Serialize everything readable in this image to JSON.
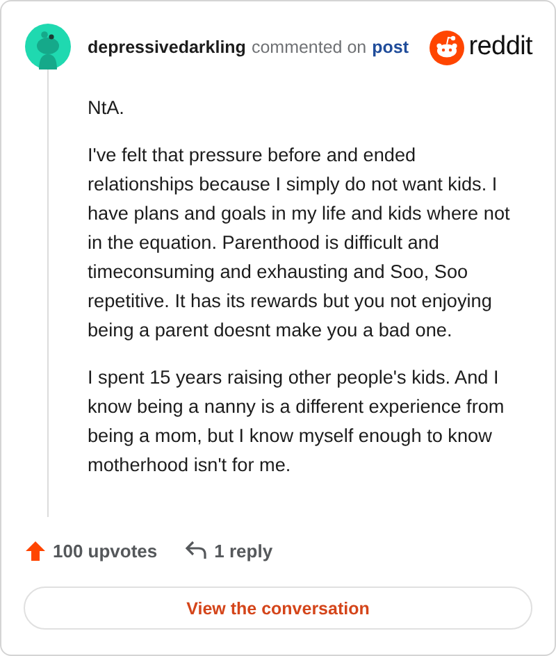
{
  "header": {
    "username": "depressivedarkling",
    "action": "commented on",
    "link": "post",
    "brand": "reddit"
  },
  "comment": {
    "paragraphs": [
      "NtA.",
      "I've felt that pressure before and ended relationships because I simply do not want kids. I have plans and goals in my life and kids where not in the equation. Parenthood is difficult and timeconsuming and exhausting and Soo, Soo repetitive. It has its rewards but you not enjoying being a parent doesnt make you a bad one.",
      "I spent 15 years raising other people's kids. And I know being a nanny is a different experience from being a mom, but I know myself enough to know motherhood isn't for me."
    ]
  },
  "footer": {
    "upvotes": "100 upvotes",
    "replies": "1 reply"
  },
  "button": "View the conversation"
}
